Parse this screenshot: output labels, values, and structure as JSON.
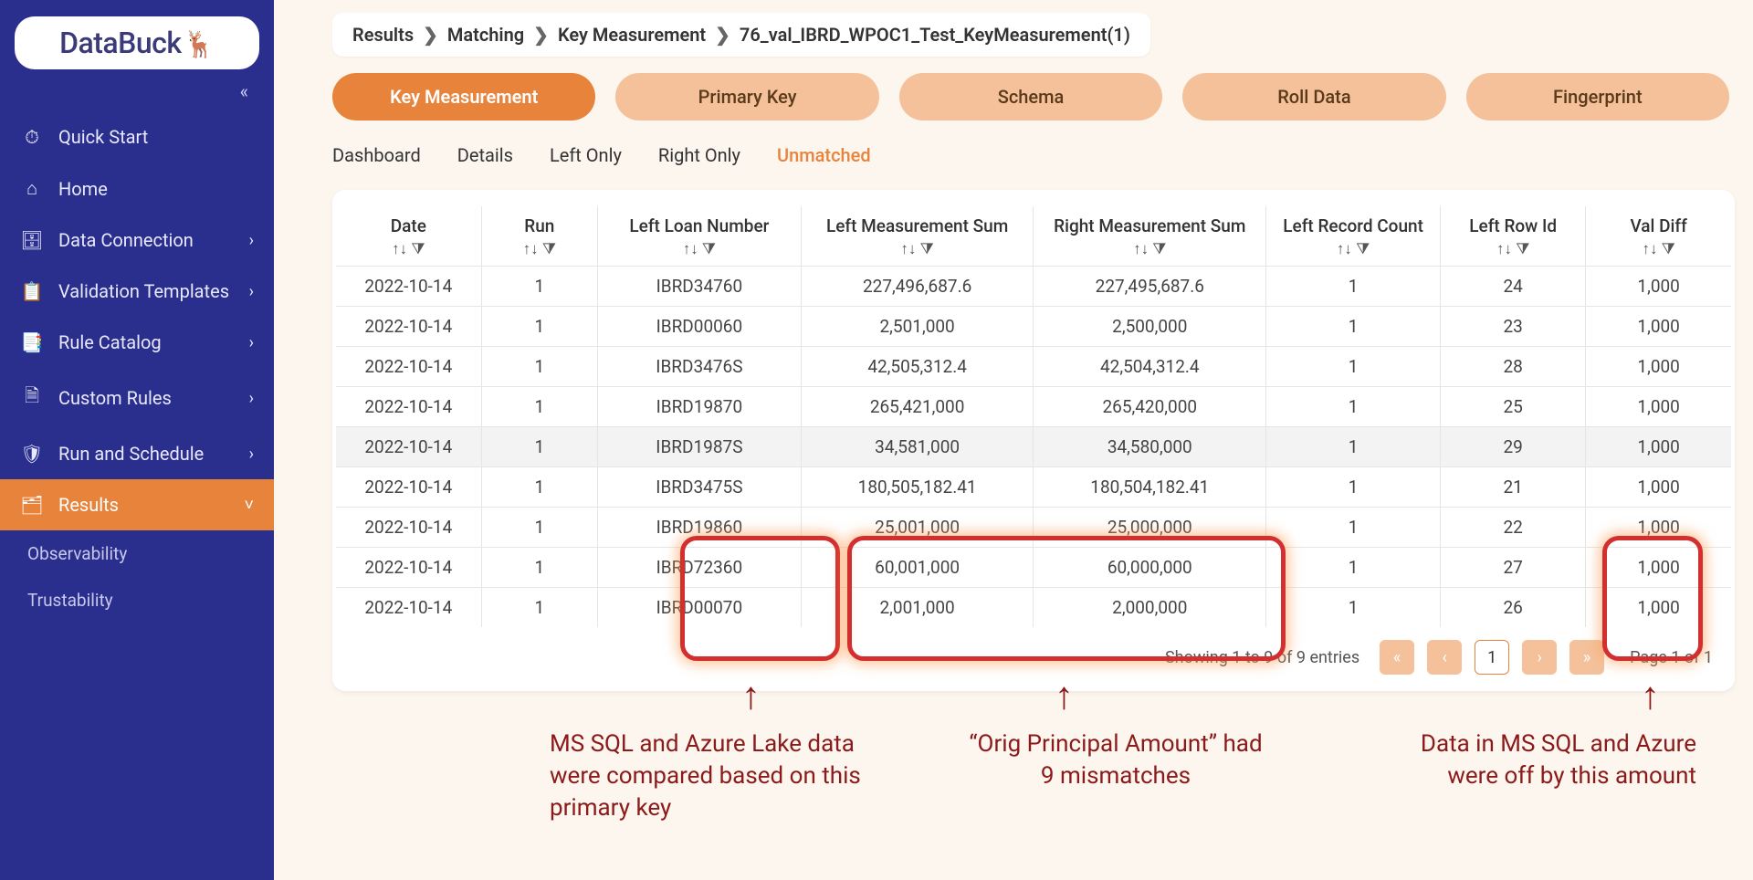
{
  "logo": "DataBuck",
  "collapse_glyph": "«",
  "sidebar": {
    "items": [
      {
        "icon": "stopwatch-icon",
        "glyph": "⏱",
        "label": "Quick Start",
        "expandable": false
      },
      {
        "icon": "home-icon",
        "glyph": "⌂",
        "label": "Home",
        "expandable": false
      },
      {
        "icon": "database-icon",
        "glyph": "🗄",
        "label": "Data Connection",
        "expandable": true
      },
      {
        "icon": "template-icon",
        "glyph": "📋",
        "label": "Validation Templates",
        "expandable": true
      },
      {
        "icon": "catalog-icon",
        "glyph": "📑",
        "label": "Rule Catalog",
        "expandable": true
      },
      {
        "icon": "file-icon",
        "glyph": "🗎",
        "label": "Custom Rules",
        "expandable": true
      },
      {
        "icon": "shield-icon",
        "glyph": "🛡",
        "label": "Run and Schedule",
        "expandable": true
      },
      {
        "icon": "results-icon",
        "glyph": "🗂",
        "label": "Results",
        "expandable": true,
        "active": true
      }
    ],
    "sub": [
      "Observability",
      "Trustability"
    ]
  },
  "breadcrumb": [
    "Results",
    "Matching",
    "Key Measurement",
    "76_val_IBRD_WPOC1_Test_KeyMeasurement(1)"
  ],
  "pills": [
    "Key Measurement",
    "Primary Key",
    "Schema",
    "Roll Data",
    "Fingerprint"
  ],
  "pills_active": 0,
  "subtabs": [
    "Dashboard",
    "Details",
    "Left Only",
    "Right Only",
    "Unmatched"
  ],
  "subtabs_active": 4,
  "columns": [
    "Date",
    "Run",
    "Left Loan Number",
    "Left Measurement Sum",
    "Right Measurement Sum",
    "Left Record Count",
    "Left Row Id",
    "Val Diff"
  ],
  "sort_filter_glyph": "↑↓ ⧩",
  "rows": [
    [
      "2022-10-14",
      "1",
      "IBRD34760",
      "227,496,687.6",
      "227,495,687.6",
      "1",
      "24",
      "1,000"
    ],
    [
      "2022-10-14",
      "1",
      "IBRD00060",
      "2,501,000",
      "2,500,000",
      "1",
      "23",
      "1,000"
    ],
    [
      "2022-10-14",
      "1",
      "IBRD3476S",
      "42,505,312.4",
      "42,504,312.4",
      "1",
      "28",
      "1,000"
    ],
    [
      "2022-10-14",
      "1",
      "IBRD19870",
      "265,421,000",
      "265,420,000",
      "1",
      "25",
      "1,000"
    ],
    [
      "2022-10-14",
      "1",
      "IBRD1987S",
      "34,581,000",
      "34,580,000",
      "1",
      "29",
      "1,000"
    ],
    [
      "2022-10-14",
      "1",
      "IBRD3475S",
      "180,505,182.41",
      "180,504,182.41",
      "1",
      "21",
      "1,000"
    ],
    [
      "2022-10-14",
      "1",
      "IBRD19860",
      "25,001,000",
      "25,000,000",
      "1",
      "22",
      "1,000"
    ],
    [
      "2022-10-14",
      "1",
      "IBRD72360",
      "60,001,000",
      "60,000,000",
      "1",
      "27",
      "1,000"
    ],
    [
      "2022-10-14",
      "1",
      "IBRD00070",
      "2,001,000",
      "2,000,000",
      "1",
      "26",
      "1,000"
    ]
  ],
  "hover_row_index": 4,
  "footer": {
    "info": "Showing 1 to 9 of 9 entries",
    "first": "«",
    "prev": "‹",
    "current": "1",
    "next": "›",
    "last": "»",
    "page_label": "Page 1 of 1"
  },
  "annotations": {
    "a1": "MS SQL and Azure Lake data were compared based on this primary key",
    "a2": "“Orig Principal Amount” had 9 mismatches",
    "a3": "Data in MS SQL and Azure were off by this amount"
  }
}
